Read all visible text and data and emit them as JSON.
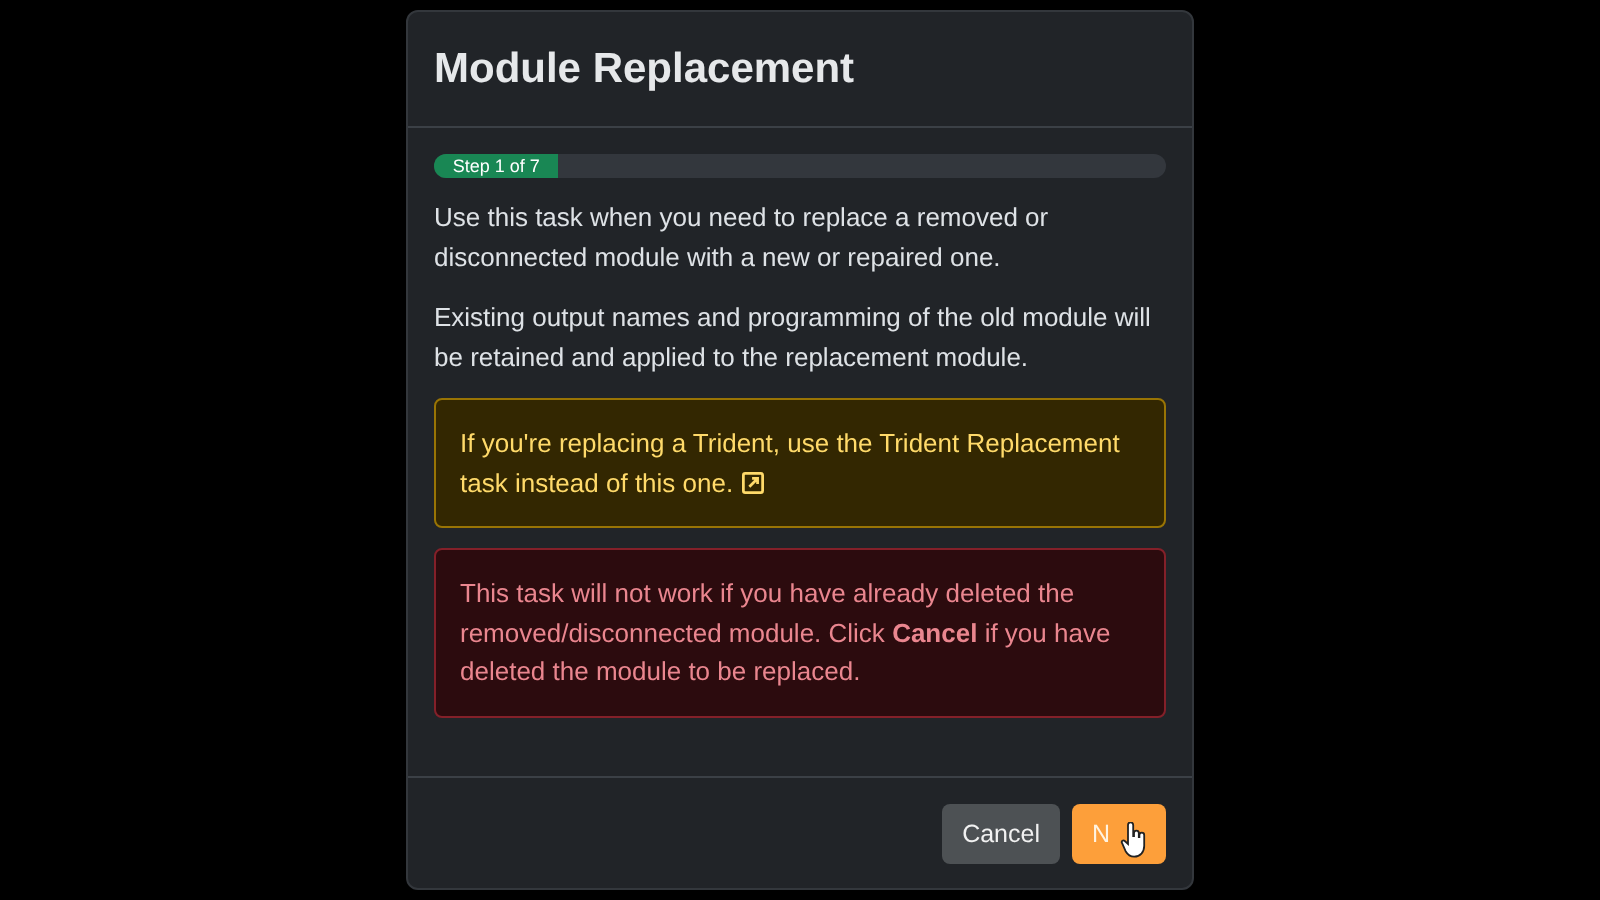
{
  "dialog": {
    "title": "Module Replacement",
    "progress": {
      "label": "Step 1 of 7",
      "level": 0.17
    },
    "paragraphs": [
      "Use this task when you need to replace a removed or disconnected module with a new or repaired one.",
      "Existing output names and programming of the old module will be retained and applied to the replacement module."
    ],
    "alerts": [
      {
        "kind": "warning",
        "text": "If you're replacing a Trident, use the Trident Replacement task instead of this one.",
        "link_icon": true
      },
      {
        "kind": "danger",
        "text": "This task will not work if you have already deleted the removed/disconnected module. Click **Cancel** if you have deleted the module to be replaced.",
        "link_icon": false
      }
    ],
    "buttons": [
      {
        "kind": "secondary",
        "label": "Cancel"
      },
      {
        "kind": "primary",
        "label": "N"
      }
    ]
  }
}
